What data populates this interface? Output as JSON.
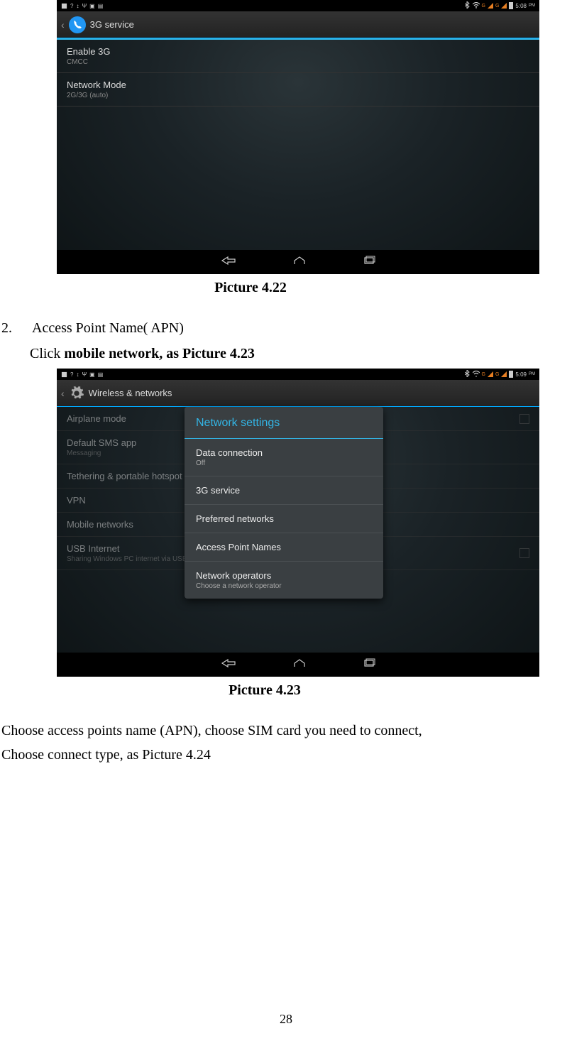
{
  "screenshot1": {
    "status_time": "5:08",
    "status_suffix": "PM",
    "action_bar_title": "3G service",
    "items": [
      {
        "label": "Enable 3G",
        "sub": "CMCC"
      },
      {
        "label": "Network Mode",
        "sub": "2G/3G (auto)"
      }
    ]
  },
  "caption1": "Picture 4.22",
  "step_number": "2.",
  "step_title": "Access Point Name( APN)",
  "step_instruction_prefix": "Click ",
  "step_instruction_bold": "mobile network, as Picture 4.23",
  "screenshot2": {
    "status_time": "5:09",
    "status_suffix": "PM",
    "action_bar_title": "Wireless & networks",
    "background_items": [
      {
        "label": "Airplane mode",
        "sub": "",
        "checkbox": true
      },
      {
        "label": "Default SMS app",
        "sub": "Messaging",
        "checkbox": false
      },
      {
        "label": "Tethering & portable hotspot",
        "sub": "",
        "checkbox": false
      },
      {
        "label": "VPN",
        "sub": "",
        "checkbox": false
      },
      {
        "label": "Mobile networks",
        "sub": "",
        "checkbox": false
      },
      {
        "label": "USB Internet",
        "sub": "Sharing Windows PC internet via USB cable",
        "checkbox": true
      }
    ],
    "popup_title": "Network settings",
    "popup_items": [
      {
        "label": "Data connection",
        "sub": "Off"
      },
      {
        "label": "3G service",
        "sub": ""
      },
      {
        "label": "Preferred networks",
        "sub": ""
      },
      {
        "label": "Access Point Names",
        "sub": ""
      },
      {
        "label": "Network operators",
        "sub": "Choose a network operator"
      }
    ]
  },
  "caption2": "Picture 4.23",
  "para1": "Choose access points name (APN), choose SIM card you need to connect,",
  "para2": "Choose connect type, as Picture 4.24",
  "page_number": "28"
}
